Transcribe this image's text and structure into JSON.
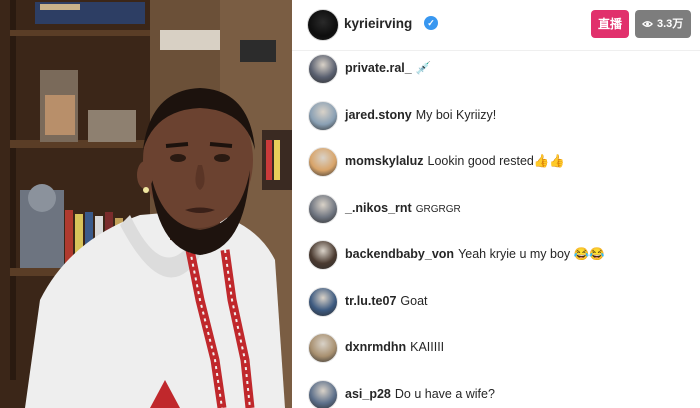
{
  "header": {
    "username": "kyrieirving",
    "live_label": "直播",
    "viewer_count": "3.3万"
  },
  "comments": [
    {
      "user": "private.ral_",
      "text": "💉",
      "avatar_color": "#5a6070"
    },
    {
      "user": "jared.stony",
      "text": "My boi Kyriizy!",
      "avatar_color": "#8aa0b4"
    },
    {
      "user": "momskylaluz",
      "text": "Lookin good rested👍👍",
      "avatar_color": "#d8a46a"
    },
    {
      "user": "_.nikos_rnt",
      "text": "GRGRGR",
      "avatar_color": "#6f7580"
    },
    {
      "user": "backendbaby_von",
      "text": "Yeah kryie u my boy 😂😂",
      "avatar_color": "#4a3a30"
    },
    {
      "user": "tr.lu.te07",
      "text": "Goat",
      "avatar_color": "#3d5a80"
    },
    {
      "user": "dxnrmdhn",
      "text": "KAIIIII",
      "avatar_color": "#a89070"
    },
    {
      "user": "asi_p28",
      "text": "Do u have a wife?",
      "avatar_color": "#5c6f8a"
    }
  ],
  "colors": {
    "live_badge": "#e1306c",
    "viewers_badge": "#7d7d7d",
    "verified": "#3897f0"
  }
}
